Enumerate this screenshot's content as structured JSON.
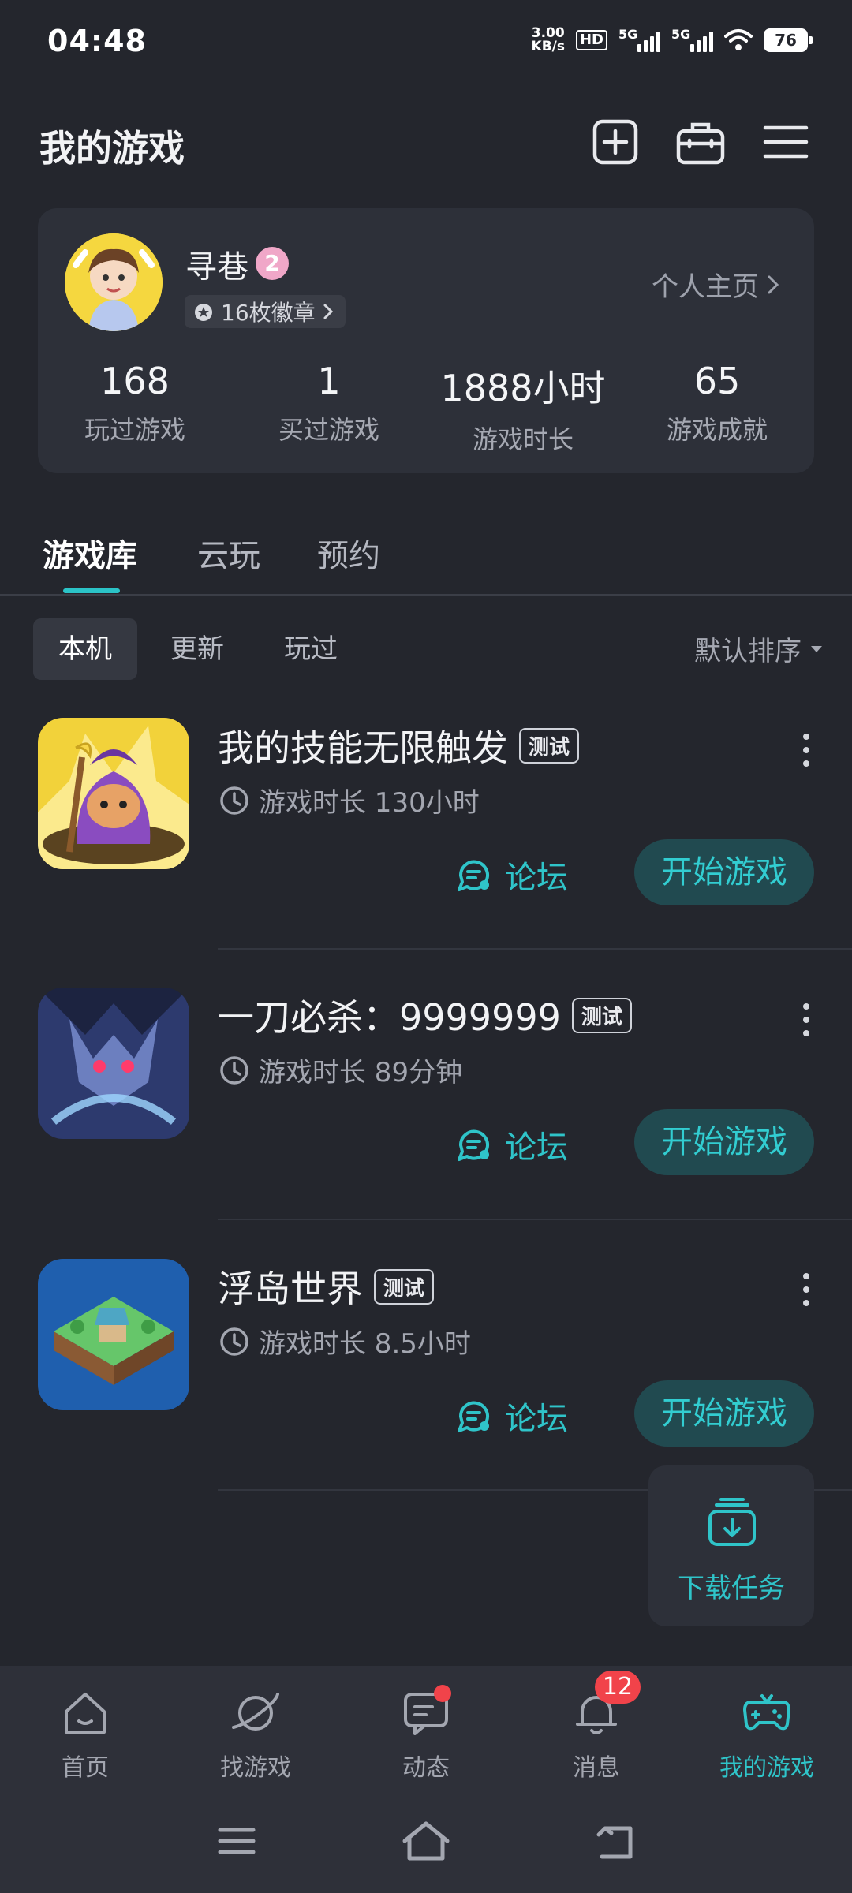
{
  "status": {
    "time": "04:48",
    "speed_value": "3.00",
    "speed_unit": "KB/s",
    "hd": "HD",
    "net1": "5G",
    "net2": "5G",
    "battery": "76"
  },
  "header": {
    "title": "我的游戏",
    "icons": [
      "add-icon",
      "toolbox-icon",
      "menu-icon"
    ]
  },
  "profile": {
    "username": "寻巷",
    "level": "2",
    "badges": "16枚徽章",
    "home_link": "个人主页",
    "stats": [
      {
        "value": "168",
        "label": "玩过游戏"
      },
      {
        "value": "1",
        "label": "买过游戏"
      },
      {
        "value": "1888小时",
        "label": "游戏时长"
      },
      {
        "value": "65",
        "label": "游戏成就"
      }
    ]
  },
  "tabs": [
    {
      "label": "游戏库",
      "active": true
    },
    {
      "label": "云玩",
      "active": false
    },
    {
      "label": "预约",
      "active": false
    }
  ],
  "filters": [
    {
      "label": "本机",
      "active": true
    },
    {
      "label": "更新",
      "active": false
    },
    {
      "label": "玩过",
      "active": false
    }
  ],
  "sort": "默认排序",
  "games": [
    {
      "name": "我的技能无限触发",
      "tag": "测试",
      "playtime": "游戏时长 130小时",
      "forum": "论坛",
      "start": "开始游戏"
    },
    {
      "name": "一刀必杀：9999999",
      "tag": "测试",
      "playtime": "游戏时长 89分钟",
      "forum": "论坛",
      "start": "开始游戏"
    },
    {
      "name": "浮岛世界",
      "tag": "测试",
      "playtime": "游戏时长 8.5小时",
      "forum": "论坛",
      "start": "开始游戏"
    }
  ],
  "download": {
    "label": "下载任务"
  },
  "nav": [
    {
      "label": "首页",
      "icon": "home-icon"
    },
    {
      "label": "找游戏",
      "icon": "planet-icon"
    },
    {
      "label": "动态",
      "icon": "chat-icon"
    },
    {
      "label": "消息",
      "icon": "bell-icon",
      "badge": "12"
    },
    {
      "label": "我的游戏",
      "icon": "gamepad-icon",
      "active": true
    }
  ],
  "colors": {
    "background": "#24262d",
    "card": "#2d3039",
    "accent": "#2fc4c9",
    "start_button_bg": "#214a50",
    "badge_red": "#f1434a"
  }
}
